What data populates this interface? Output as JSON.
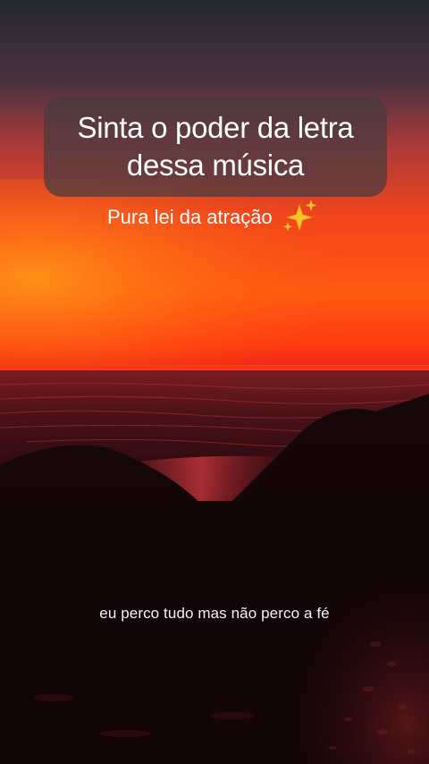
{
  "overlay": {
    "title_line1": "Sinta o poder da letra",
    "title_line2": "dessa música",
    "subtitle": "Pura lei da atração",
    "subtitle_icon": "sparkles-icon"
  },
  "caption": {
    "lyric": "eu perco tudo mas não perco a fé"
  },
  "colors": {
    "sky_top": "#2b2d34",
    "sky_glow": "#ff4a12",
    "horizon": "#ff2a10",
    "sea": "#3a0d12",
    "sand": "#120507",
    "card_bg": "#463a40",
    "sparkle": "#f7c52a"
  }
}
